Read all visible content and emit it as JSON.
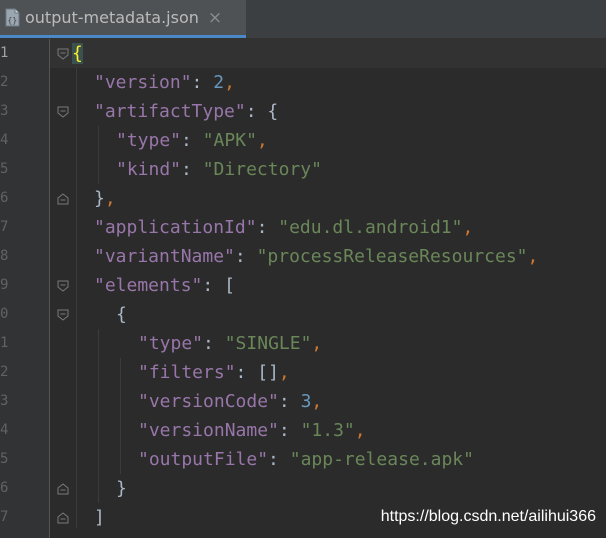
{
  "tab": {
    "title": "output-metadata.json",
    "close_glyph": "×",
    "icon": "json-file-icon"
  },
  "colors": {
    "key": "#9876aa",
    "string": "#6a8759",
    "number": "#6897bb",
    "punctuation": "#cc7832",
    "text": "#a9b7c6"
  },
  "gutter": {
    "line_numbers": [
      "1",
      "2",
      "3",
      "4",
      "5",
      "6",
      "7",
      "8",
      "9",
      "0",
      "1",
      "2",
      "3",
      "4",
      "5",
      "6",
      "7"
    ]
  },
  "code": {
    "l1": {
      "open": "{"
    },
    "l2": {
      "key": "\"version\"",
      "colon": ": ",
      "num": "2",
      "comma": ","
    },
    "l3": {
      "key": "\"artifactType\"",
      "colon": ": ",
      "open": "{"
    },
    "l4": {
      "key": "\"type\"",
      "colon": ": ",
      "str": "\"APK\"",
      "comma": ","
    },
    "l5": {
      "key": "\"kind\"",
      "colon": ": ",
      "str": "\"Directory\""
    },
    "l6": {
      "close": "}",
      "comma": ","
    },
    "l7": {
      "key": "\"applicationId\"",
      "colon": ": ",
      "str": "\"edu.dl.android1\"",
      "comma": ","
    },
    "l8": {
      "key": "\"variantName\"",
      "colon": ": ",
      "str": "\"processReleaseResources\"",
      "comma": ","
    },
    "l9": {
      "key": "\"elements\"",
      "colon": ": ",
      "open": "["
    },
    "l10": {
      "open": "{"
    },
    "l11": {
      "key": "\"type\"",
      "colon": ": ",
      "str": "\"SINGLE\"",
      "comma": ","
    },
    "l12": {
      "key": "\"filters\"",
      "colon": ": ",
      "val": "[]",
      "comma": ","
    },
    "l13": {
      "key": "\"versionCode\"",
      "colon": ": ",
      "num": "3",
      "comma": ","
    },
    "l14": {
      "key": "\"versionName\"",
      "colon": ": ",
      "str": "\"1.3\"",
      "comma": ","
    },
    "l15": {
      "key": "\"outputFile\"",
      "colon": ": ",
      "str": "\"app-release.apk\""
    },
    "l16": {
      "close": "}"
    },
    "l17": {
      "close": "]"
    }
  },
  "watermark": "https://blog.csdn.net/ailihui366"
}
